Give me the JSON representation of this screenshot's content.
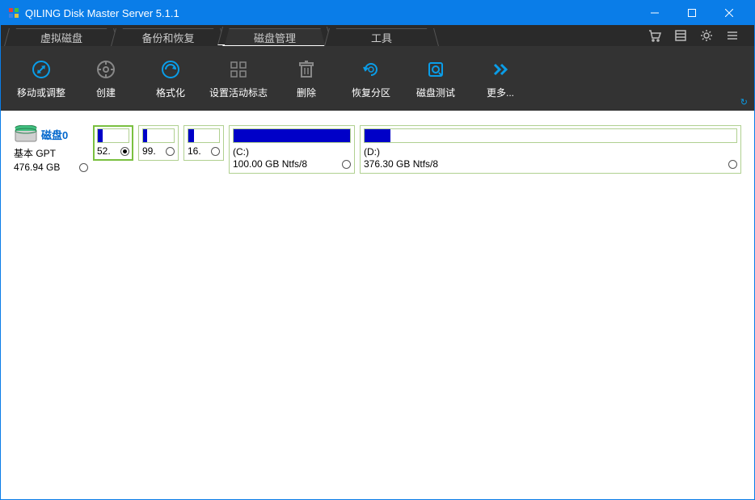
{
  "window": {
    "title": "QILING Disk Master Server 5.1.1"
  },
  "tabs": [
    {
      "label": "虚拟磁盘",
      "active": false
    },
    {
      "label": "备份和恢复",
      "active": false
    },
    {
      "label": "磁盘管理",
      "active": true
    },
    {
      "label": "工具",
      "active": false
    }
  ],
  "toolbar": [
    {
      "label": "移动或调整"
    },
    {
      "label": "创建"
    },
    {
      "label": "格式化"
    },
    {
      "label": "设置活动标志"
    },
    {
      "label": "删除"
    },
    {
      "label": "恢复分区"
    },
    {
      "label": "磁盘测试"
    },
    {
      "label": "更多..."
    }
  ],
  "disk": {
    "name": "磁盘0",
    "type": "基本 GPT",
    "size": "476.94 GB"
  },
  "partitions": [
    {
      "size_short": "52.",
      "fill_pct": 16,
      "selected": true
    },
    {
      "size_short": "99.",
      "fill_pct": 14,
      "selected": false
    },
    {
      "size_short": "16.",
      "fill_pct": 18,
      "selected": false
    },
    {
      "label": "(C:)",
      "size": "100.00 GB Ntfs/8",
      "fill_pct": 100,
      "selected": false
    },
    {
      "label": "(D:)",
      "size": "376.30 GB Ntfs/8",
      "fill_pct": 7,
      "selected": false
    }
  ]
}
